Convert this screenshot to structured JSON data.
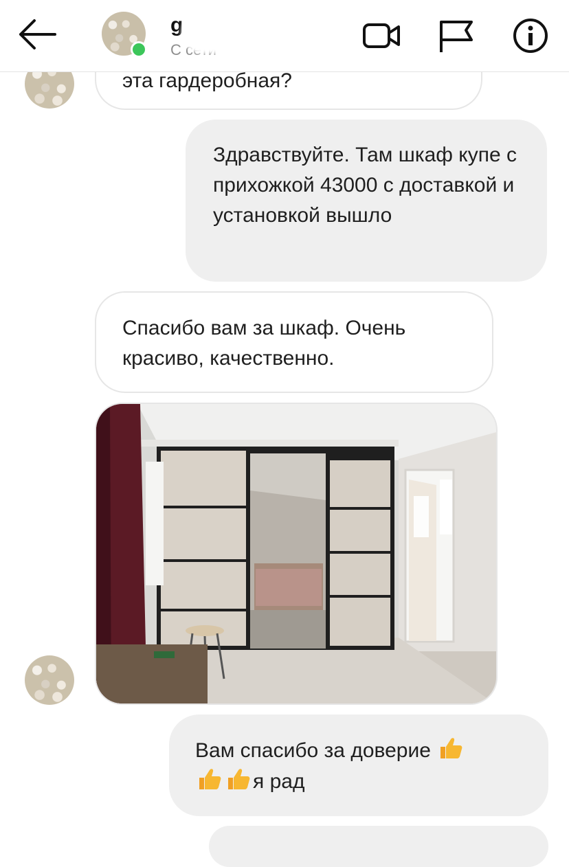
{
  "header": {
    "contact_name": "g",
    "contact_status": "С сети",
    "icons": [
      "back-arrow-icon",
      "video-call-icon",
      "flag-icon",
      "info-icon"
    ],
    "online_color": "#3cc65a"
  },
  "messages": [
    {
      "direction": "incoming",
      "text": "эта гардеробная?"
    },
    {
      "direction": "outgoing",
      "text": "Здравствуйте. Там шкаф купе с прихожкой 43000 с доставкой и установкой вышло"
    },
    {
      "direction": "incoming",
      "text": "Спасибо вам за шкаф. Очень красиво, качественно."
    },
    {
      "direction": "incoming",
      "type": "photo"
    },
    {
      "direction": "outgoing",
      "text_start": "Вам спасибо за доверие",
      "text_end": "я рад",
      "emoji": "thumbs-up-icon"
    }
  ]
}
